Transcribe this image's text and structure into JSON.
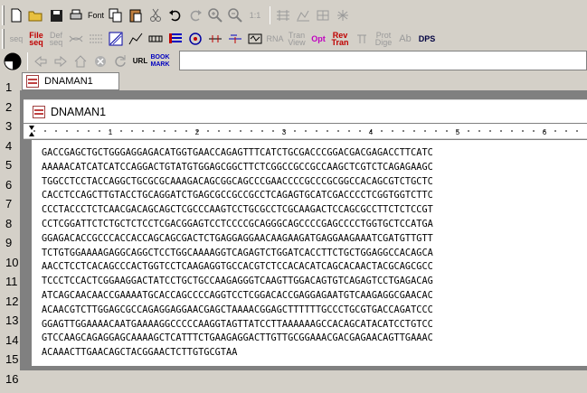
{
  "toolbar1": {
    "items": [
      "new-file-icon",
      "open-folder-icon",
      "save-disk-icon",
      "print-icon",
      "font-label",
      "copy-icon",
      "paste-icon",
      "cut-icon",
      "undo-icon",
      "redo-icon",
      "zoom-in-icon",
      "zoom-out-icon",
      "zoom-actual-icon",
      "tool-a-icon",
      "tool-b-icon",
      "tool-c-icon",
      "tool-d-icon"
    ],
    "font_label": "Font",
    "zoom_label": "1:1"
  },
  "toolbar2": {
    "labels": {
      "seq": "seq",
      "file_seq": "File\nseq",
      "def_seq": "Def\nseq",
      "rna": "RNA",
      "tran_view": "Tran\nView",
      "opt": "Opt",
      "rev_tran": "Rev\nTran",
      "prot_dige": "Prot\nDige",
      "ab": "Ab",
      "dps": "DPS"
    }
  },
  "toolbar3": {
    "url_label": "URL",
    "bookmark_label": "BOOK\nMARK",
    "url_value": ""
  },
  "outer_tab": {
    "label": "DNAMAN1"
  },
  "child_window": {
    "title": "DNAMAN1"
  },
  "ruler": {
    "marks": [
      "1",
      "2",
      "3",
      "4",
      "5",
      "6"
    ]
  },
  "row_numbers": [
    "1",
    "2",
    "3",
    "4",
    "5",
    "6",
    "7",
    "8",
    "9",
    "10",
    "11",
    "12",
    "13",
    "14",
    "15",
    "16"
  ],
  "sequence_lines": [
    "GACCGAGCTGCTGGGAGGAGACATGGTGAACCAGAGTTTCATCTGCGACCCGGACGACGAGACCTTCATC",
    "AAAAACATCATCATCCAGGACTGTATGTGGAGCGGCTTCTCGGCCGCCGCCAAGCTCGTCTCAGAGAAGC",
    "TGGCCTCCTACCAGGCTGCGCGCAAAGACAGCGGCAGCCCGAACCCCGCCCGCGGCCACAGCGTCTGCTC",
    "CACCTCCAGCTTGTACCTGCAGGATCTGAGCGCCGCCGCCTCAGAGTGCATCGACCCCTCGGTGGTCTTC",
    "CCCTACCCTCTCAACGACAGCAGCTCGCCCAAGTCCTGCGCCTCGCAAGACTCCAGCGCCTTCTCTCCGT",
    "CCTCGGATTCTCTGCTCTCCTCGACGGAGTCCTCCCCGCAGGGCAGCCCCGAGCCCCTGGTGCTCCATGA",
    "GGAGACACCGCCCACCACCAGCAGCGACTCTGAGGAGGAACAAGAAGATGAGGAAGAAATCGATGTTGTT",
    "TCTGTGGAAAAGAGGCAGGCTCCTGGCAAAAGGTCAGAGTCTGGATCACCTTCTGCTGGAGGCCACAGCA",
    "AACCTCCTCACAGCCCACTGGTCCTCAAGAGGTGCCACGTCTCCACACATCAGCACAACTACGCAGCGCC",
    "TCCCTCCACTCGGAAGGACTATCCTGCTGCCAAGAGGGTCAAGTTGGACAGTGTCAGAGTCCTGAGACAG",
    "ATCAGCAACAACCGAAAATGCACCAGCCCCAGGTCCTCGGACACCGAGGAGAATGTCAAGAGGCGAACAC",
    "ACAACGTCTTGGAGCGCCAGAGGAGGAACGAGCTAAAACGGAGCTTTTTTGCCCTGCGTGACCAGATCCC",
    "GGAGTTGGAAAACAATGAAAAGGCCCCCAAGGTAGTTATCCTTAAAAAAGCCACAGCATACATCCTGTCC",
    "GTCCAAGCAGAGGAGCAAAAGCTCATTTCTGAAGAGGACTTGTTGCGGAAACGACGAGAACAGTTGAAAC",
    "ACAAACTTGAACAGCTACGGAACTCTTGTGCGTAA"
  ]
}
